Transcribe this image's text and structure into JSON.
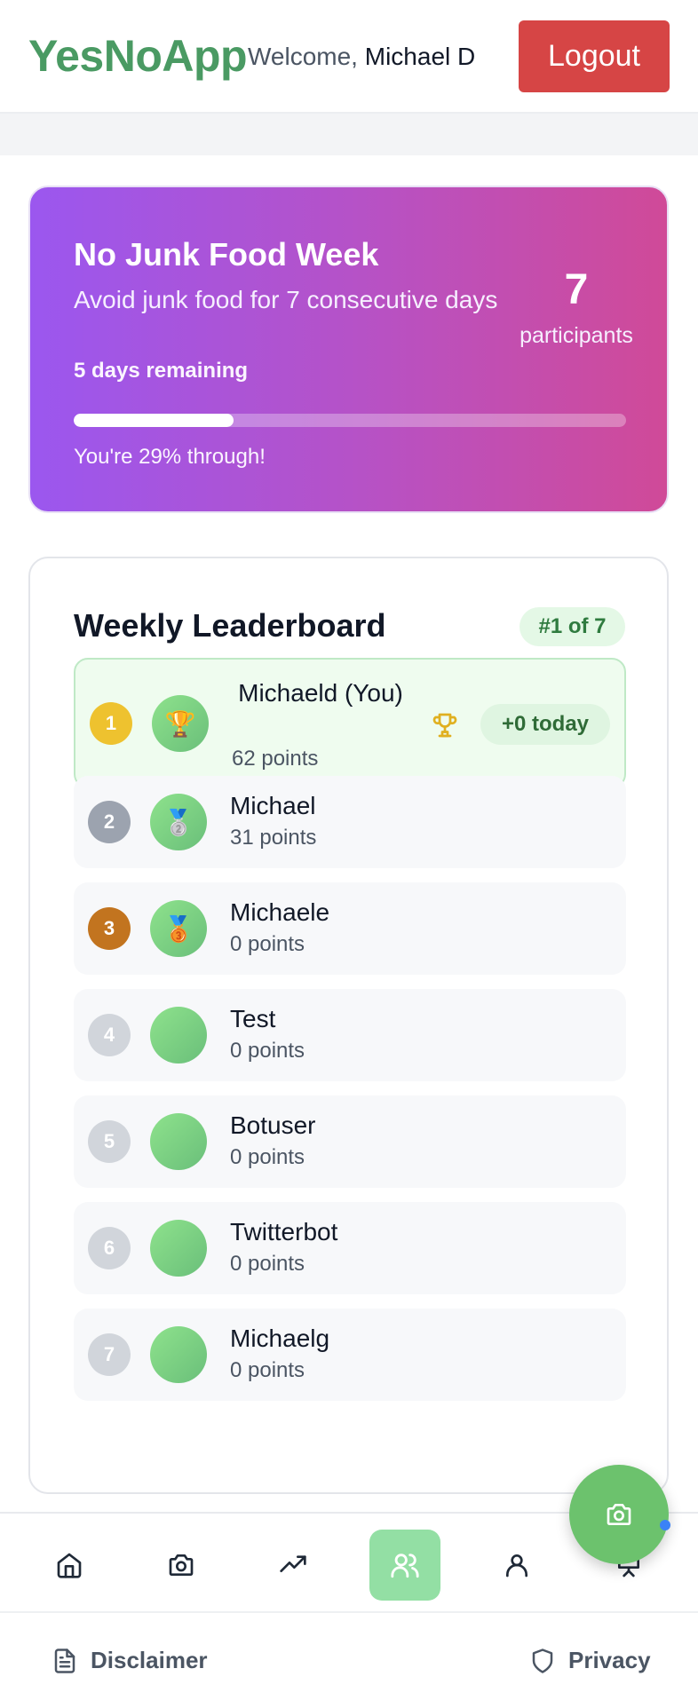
{
  "header": {
    "logo": "YesNoApp",
    "welcome_prefix": "Welcome,",
    "username": "Michael D",
    "logout_label": "Logout"
  },
  "challenge": {
    "title": "No Junk Food Week",
    "description": "Avoid junk food for 7 consecutive days",
    "remaining": "5 days remaining",
    "participants_count": "7",
    "participants_label": "participants",
    "progress_fraction": 0.29,
    "progress_text": "You're 29% through!"
  },
  "leaderboard": {
    "title": "Weekly Leaderboard",
    "rank_badge": "#1 of 7",
    "entries": [
      {
        "rank": "1",
        "name": "Michaeld (You)",
        "points": "62 points",
        "medal": "🏆",
        "today": "+0 today",
        "rank_color": "#eec22f"
      },
      {
        "rank": "2",
        "name": "Michael",
        "points": "31 points",
        "medal": "🥈",
        "rank_color": "#9ca3af"
      },
      {
        "rank": "3",
        "name": "Michaele",
        "points": "0 points",
        "medal": "🥉",
        "rank_color": "#c2741f"
      },
      {
        "rank": "4",
        "name": "Test",
        "points": "0 points",
        "medal": "",
        "rank_color": "#d1d5db"
      },
      {
        "rank": "5",
        "name": "Botuser",
        "points": "0 points",
        "medal": "",
        "rank_color": "#d1d5db"
      },
      {
        "rank": "6",
        "name": "Twitterbot",
        "points": "0 points",
        "medal": "",
        "rank_color": "#d1d5db"
      },
      {
        "rank": "7",
        "name": "Michaelg",
        "points": "0 points",
        "medal": "",
        "rank_color": "#d1d5db"
      }
    ]
  },
  "nav": {
    "items": [
      {
        "icon": "home-icon"
      },
      {
        "icon": "camera-icon"
      },
      {
        "icon": "trending-up-icon"
      },
      {
        "icon": "users-icon",
        "active": true
      },
      {
        "icon": "user-icon"
      },
      {
        "icon": "presentation-icon"
      }
    ]
  },
  "footer": {
    "disclaimer_label": "Disclaimer",
    "privacy_label": "Privacy"
  },
  "colors": {
    "brand": "#4a9a63",
    "logout": "#d64545",
    "gradient_start": "#9b57ef",
    "gradient_end": "#d04a98",
    "fab": "#6cc26d"
  }
}
